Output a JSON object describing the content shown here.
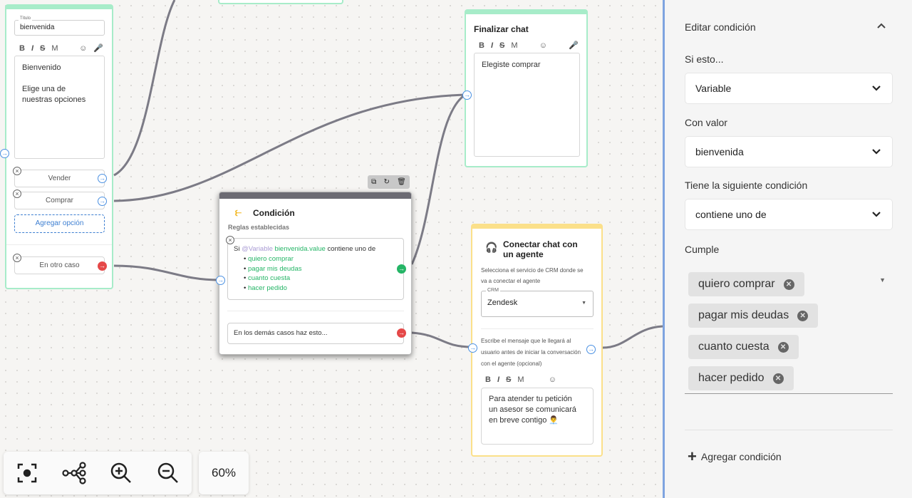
{
  "node_welcome": {
    "title_label": "Título",
    "title_value": "bienvenida",
    "format": {
      "bold": "B",
      "italic": "I",
      "strike": "S",
      "mono": "M"
    },
    "message_line1": "Bienvenido",
    "message_line2": "Elige una de",
    "message_line3": "nuestras opciones",
    "options": [
      "Vender",
      "Comprar"
    ],
    "add_option": "Agregar opción",
    "otherwise": "En otro caso"
  },
  "node_finish": {
    "title": "Finalizar chat",
    "format": {
      "bold": "B",
      "italic": "I",
      "strike": "S",
      "mono": "M"
    },
    "message": "Elegiste comprar"
  },
  "node_condition": {
    "title": "Condición",
    "subtitle": "Reglas establecidas",
    "rule_si": "Si",
    "rule_var_label": "@Variable",
    "rule_var_value": "bienvenida.value",
    "rule_op": "contiene uno de",
    "rule_items": [
      "quiero comprar",
      "pagar mis deudas",
      "cuanto cuesta",
      "hacer pedido"
    ],
    "else_text": "En los demás casos haz esto..."
  },
  "node_agent": {
    "title_line1": "Conectar chat con",
    "title_line2": "un agente",
    "desc_line1": "Selecciona el servicio de CRM donde se",
    "desc_line2": "va a conectar el agente",
    "crm_label": "CRM",
    "crm_value": "Zendesk",
    "msg_desc_line1": "Escribe el mensaje que le llegará al",
    "msg_desc_line2": "usuario antes de iniciar la conversación",
    "msg_desc_line3": "con el agente (opcional)",
    "format": {
      "bold": "B",
      "italic": "I",
      "strike": "S",
      "mono": "M"
    },
    "msg_line1": "Para atender tu petición",
    "msg_line2": "un asesor se comunicará",
    "msg_line3": "en breve contigo 👨‍💼"
  },
  "controls": {
    "zoom": "60%"
  },
  "panel": {
    "header": "Editar condición",
    "if_label": "Si esto...",
    "if_value": "Variable",
    "value_label": "Con valor",
    "value_value": "bienvenida",
    "cond_label": "Tiene la siguiente condición",
    "cond_value": "contiene uno de",
    "meets_label": "Cumple",
    "chips": [
      "quiero comprar",
      "pagar mis deudas",
      "cuanto cuesta",
      "hacer pedido"
    ],
    "add_condition": "Agregar condición"
  },
  "colors": {
    "green_border": "#a7ecc9",
    "yellow_border": "#fbe08a",
    "accent_blue": "#4a90e2",
    "var_green": "#25b566",
    "var_purple": "#a99bd4",
    "panel_border": "#7fa4e0"
  }
}
